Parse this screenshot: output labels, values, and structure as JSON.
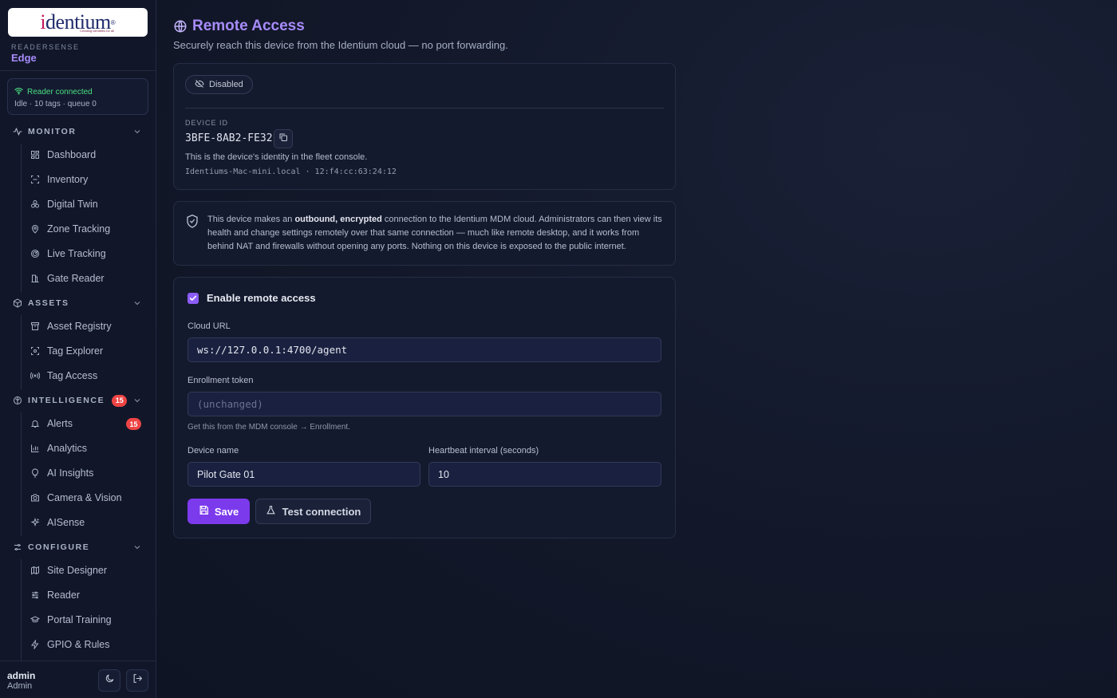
{
  "brand": {
    "logo_text": "identium",
    "logo_tagline": "Creating identities for all",
    "product_label": "READERSENSE",
    "product_name": "Edge"
  },
  "reader_status": {
    "title": "Reader connected",
    "detail": "Idle · 10 tags · queue 0",
    "color": "#4ade80"
  },
  "sidebar": {
    "sections": [
      {
        "title": "MONITOR",
        "icon": "activity-icon",
        "items": [
          {
            "label": "Dashboard",
            "icon": "dashboard-icon"
          },
          {
            "label": "Inventory",
            "icon": "scan-icon"
          },
          {
            "label": "Digital Twin",
            "icon": "boxes-icon"
          },
          {
            "label": "Zone Tracking",
            "icon": "map-pin-icon"
          },
          {
            "label": "Live Tracking",
            "icon": "radar-icon"
          },
          {
            "label": "Gate Reader",
            "icon": "gate-icon"
          }
        ]
      },
      {
        "title": "ASSETS",
        "icon": "package-icon",
        "items": [
          {
            "label": "Asset Registry",
            "icon": "archive-icon"
          },
          {
            "label": "Tag Explorer",
            "icon": "scan-search-icon"
          },
          {
            "label": "Tag Access",
            "icon": "radio-icon"
          }
        ]
      },
      {
        "title": "INTELLIGENCE",
        "icon": "brain-icon",
        "badge": "15",
        "items": [
          {
            "label": "Alerts",
            "icon": "bell-icon",
            "badge": "15"
          },
          {
            "label": "Analytics",
            "icon": "bar-chart-icon"
          },
          {
            "label": "AI Insights",
            "icon": "lightbulb-icon"
          },
          {
            "label": "Camera & Vision",
            "icon": "camera-icon"
          },
          {
            "label": "AISense",
            "icon": "sparkles-icon"
          }
        ]
      },
      {
        "title": "CONFIGURE",
        "icon": "settings-icon",
        "items": [
          {
            "label": "Site Designer",
            "icon": "map-icon"
          },
          {
            "label": "Reader",
            "icon": "sliders-icon"
          },
          {
            "label": "Portal Training",
            "icon": "graduation-cap-icon"
          },
          {
            "label": "GPIO & Rules",
            "icon": "zap-icon"
          }
        ]
      }
    ]
  },
  "user": {
    "name": "admin",
    "role": "Admin"
  },
  "page": {
    "title": "Remote Access",
    "subtitle": "Securely reach this device from the Identium cloud — no port forwarding."
  },
  "device_card": {
    "status_pill": "Disabled",
    "device_id_label": "DEVICE ID",
    "device_id": "3BFE-8AB2-FE32",
    "help": "This is the device's identity in the fleet console.",
    "host": "Identiums-Mac-mini.local · 12:f4:cc:63:24:12"
  },
  "info_card": {
    "pre": "This device makes an ",
    "bold": "outbound, encrypted",
    "post": " connection to the Identium MDM cloud. Administrators can then view its health and change settings remotely over that same connection — much like remote desktop, and it works from behind NAT and firewalls without opening any ports. Nothing on this device is exposed to the public internet."
  },
  "form": {
    "enable_label": "Enable remote access",
    "enabled": true,
    "cloud_url_label": "Cloud URL",
    "cloud_url_value": "ws://127.0.0.1:4700/agent",
    "token_label": "Enrollment token",
    "token_placeholder": "(unchanged)",
    "token_help": "Get this from the MDM console → Enrollment.",
    "device_name_label": "Device name",
    "device_name_value": "Pilot Gate 01",
    "heartbeat_label": "Heartbeat interval (seconds)",
    "heartbeat_value": "10",
    "save_label": "Save",
    "test_label": "Test connection"
  },
  "colors": {
    "accent": "#a78bfa",
    "primary_button": "#7c3aed",
    "badge": "#ef4444"
  }
}
